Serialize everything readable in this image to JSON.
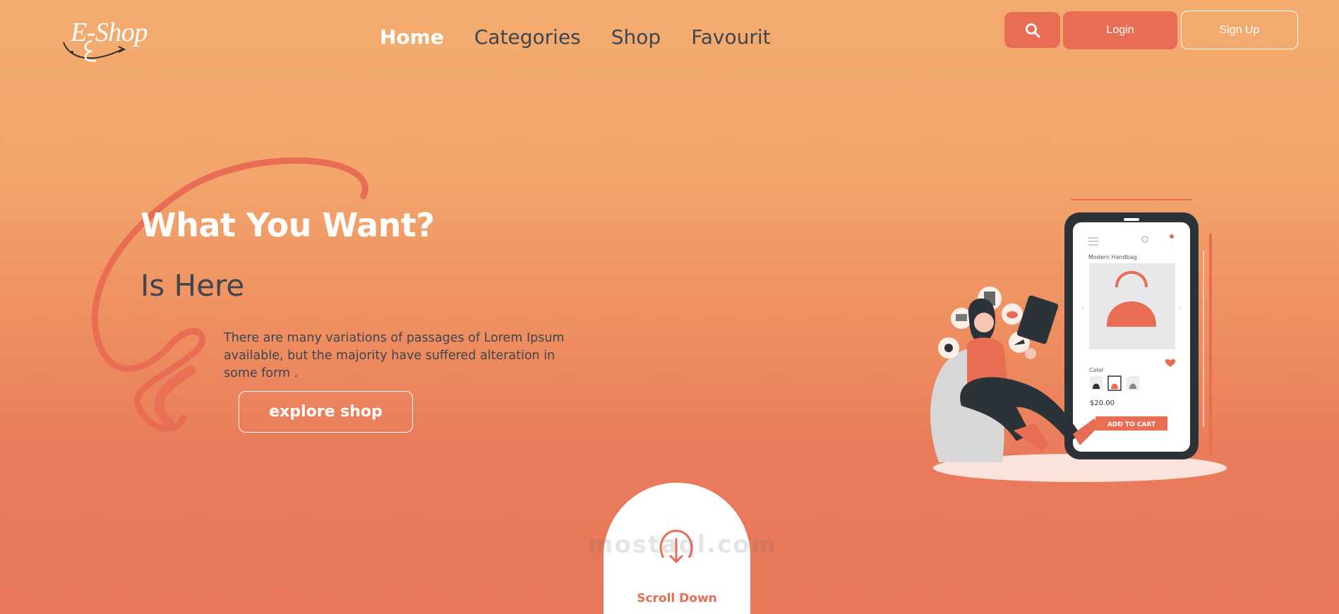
{
  "brand": {
    "name": "E-Shop"
  },
  "nav": {
    "items": [
      {
        "label": "Home",
        "active": true
      },
      {
        "label": "Categories",
        "active": false
      },
      {
        "label": "Shop",
        "active": false
      },
      {
        "label": "Favourit",
        "active": false
      }
    ]
  },
  "header": {
    "search_icon": "search-icon",
    "login_label": "Login",
    "signup_label": "Sign Up"
  },
  "hero": {
    "title": "What You Want?",
    "subtitle": "Is Here",
    "description": "There are many variations of passages of Lorem Ipsum available, but the majority have suffered alteration in some form .",
    "cta_label": "explore shop"
  },
  "phone": {
    "product_title": "Modern Handbag",
    "color_label": "Color",
    "price": "$20.00",
    "cart_label": "ADD TO CART"
  },
  "scroll": {
    "label": "Scroll Down"
  },
  "watermark": {
    "text": "mostaql.com"
  },
  "colors": {
    "accent": "#e96d55",
    "text_dark": "#3d4650",
    "gradient_top": "#f3ab6f",
    "gradient_bottom": "#e8775a"
  }
}
